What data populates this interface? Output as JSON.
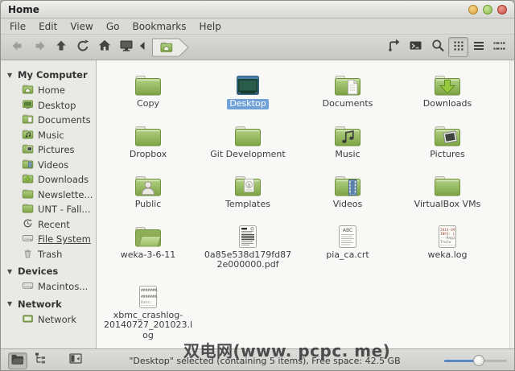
{
  "window": {
    "title": "Home",
    "controls": [
      {
        "name": "minimize",
        "color1": "#f3d489",
        "color2": "#dda43e",
        "border": "#b3882f"
      },
      {
        "name": "maximize",
        "color1": "#cbe69d",
        "color2": "#87b94b",
        "border": "#6f9c3a"
      },
      {
        "name": "close",
        "color1": "#e99c90",
        "color2": "#c94e3e",
        "border": "#a63d2f"
      }
    ]
  },
  "menu": {
    "items": [
      "File",
      "Edit",
      "View",
      "Go",
      "Bookmarks",
      "Help"
    ]
  },
  "toolbar": {
    "nav": [
      {
        "icon": "back-icon",
        "enabled": false
      },
      {
        "icon": "forward-icon",
        "enabled": false
      },
      {
        "icon": "up-icon",
        "enabled": true
      },
      {
        "icon": "refresh-icon",
        "enabled": true
      },
      {
        "icon": "home-icon",
        "enabled": true
      },
      {
        "icon": "computer-icon",
        "enabled": true
      },
      {
        "icon": "collapse-breadcrumbs-icon",
        "enabled": true,
        "narrow": true
      }
    ],
    "breadcrumb": {
      "name": "home-breadcrumb",
      "icon": "breadcrumb-home-icon"
    },
    "right": [
      {
        "icon": "edit-location-icon"
      },
      {
        "icon": "terminal-icon"
      },
      {
        "icon": "search-icon"
      }
    ],
    "views": [
      {
        "icon": "icon-view-icon",
        "active": true
      },
      {
        "icon": "list-view-icon",
        "active": false
      },
      {
        "icon": "compact-view-icon",
        "active": false
      }
    ]
  },
  "sidebar": {
    "sections": [
      {
        "header": "My Computer",
        "items": [
          {
            "label": "Home",
            "icon": "sb-home"
          },
          {
            "label": "Desktop",
            "icon": "sb-desktop"
          },
          {
            "label": "Documents",
            "icon": "sb-folder-doc"
          },
          {
            "label": "Music",
            "icon": "sb-folder-music"
          },
          {
            "label": "Pictures",
            "icon": "sb-folder-pic"
          },
          {
            "label": "Videos",
            "icon": "sb-folder-vid"
          },
          {
            "label": "Downloads",
            "icon": "sb-folder-dl"
          },
          {
            "label": "Newslette...",
            "icon": "sb-folder"
          },
          {
            "label": "UNT - Fall...",
            "icon": "sb-folder"
          },
          {
            "label": "Recent",
            "icon": "sb-recent"
          },
          {
            "label": "File System",
            "icon": "sb-drive",
            "underline": true
          },
          {
            "label": "Trash",
            "icon": "sb-trash"
          }
        ]
      },
      {
        "header": "Devices",
        "items": [
          {
            "label": "Macintos...",
            "icon": "sb-drive"
          }
        ]
      },
      {
        "header": "Network",
        "items": [
          {
            "label": "Network",
            "icon": "sb-network"
          }
        ]
      }
    ]
  },
  "files": {
    "selected_accent": "#70a2d8",
    "items": [
      {
        "name": "Copy",
        "icon": "folder",
        "selected": false
      },
      {
        "name": "Desktop",
        "icon": "desktop",
        "selected": true
      },
      {
        "name": "Documents",
        "icon": "folder-documents",
        "selected": false
      },
      {
        "name": "Downloads",
        "icon": "folder-downloads",
        "selected": false
      },
      {
        "name": "Dropbox",
        "icon": "folder",
        "selected": false
      },
      {
        "name": "Git Development",
        "icon": "folder",
        "selected": false
      },
      {
        "name": "Music",
        "icon": "folder-music",
        "selected": false
      },
      {
        "name": "Pictures",
        "icon": "folder-pictures",
        "selected": false
      },
      {
        "name": "Public",
        "icon": "folder-public",
        "selected": false
      },
      {
        "name": "Templates",
        "icon": "folder-templates",
        "selected": false
      },
      {
        "name": "Videos",
        "icon": "folder-videos",
        "selected": false
      },
      {
        "name": "VirtualBox VMs",
        "icon": "folder",
        "selected": false
      },
      {
        "name": "weka-3-6-11",
        "icon": "folder-open",
        "selected": false
      },
      {
        "name": "0a85e538d179fd872e000000.pdf",
        "icon": "file-pdf",
        "selected": false
      },
      {
        "name": "pia_ca.crt",
        "icon": "file-cert",
        "selected": false
      },
      {
        "name": "weka.log",
        "icon": "file-log",
        "selected": false
      },
      {
        "name": "xbmc_crashlog-20140727_201023.log",
        "icon": "file-log-hash",
        "selected": false
      }
    ]
  },
  "statusbar": {
    "buttons": [
      {
        "icon": "places-icon",
        "pressed": true
      },
      {
        "icon": "treeview-icon",
        "pressed": false
      },
      {
        "icon": "toggle-sidebar-icon",
        "pressed": false
      }
    ],
    "text": "\"Desktop\" selected (containing 5 items), Free space: 42.5 GB",
    "zoom_slider_percent": 55
  },
  "watermark": {
    "text": "双电网(www. pcpc. me)"
  }
}
